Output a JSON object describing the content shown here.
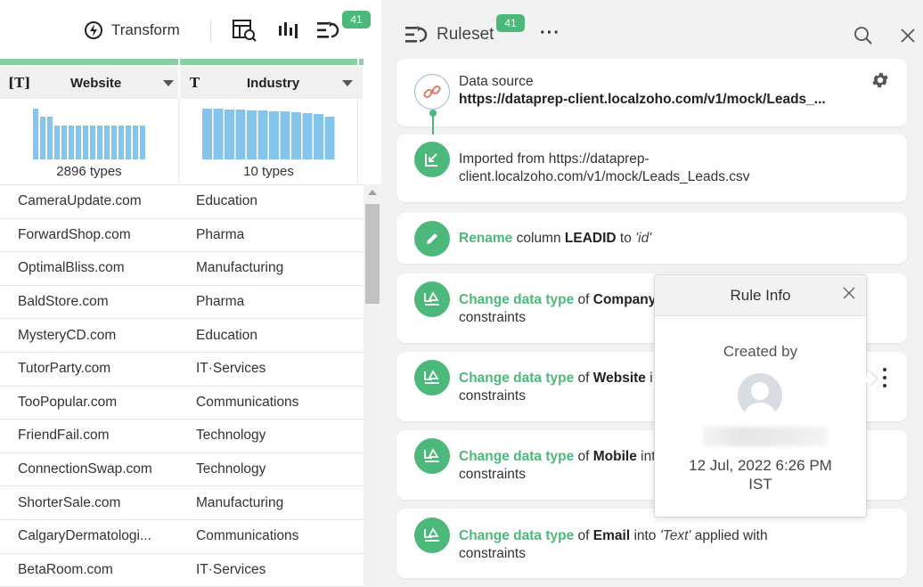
{
  "toolbar": {
    "transform_label": "Transform",
    "ruleset_badge": "41"
  },
  "grid": {
    "columns": [
      {
        "type_icon": "text-type-icon",
        "type_glyph": "[T]",
        "name": "Website",
        "histogram_caption": "2896 types"
      },
      {
        "type_icon": "text-type-icon",
        "type_glyph": "T",
        "name": "Industry",
        "histogram_caption": "10 types"
      }
    ],
    "rows": [
      [
        "CameraUpdate.com",
        "Education"
      ],
      [
        "ForwardShop.com",
        "Pharma"
      ],
      [
        "OptimalBliss.com",
        "Manufacturing"
      ],
      [
        "BaldStore.com",
        "Pharma"
      ],
      [
        "MysteryCD.com",
        "Education"
      ],
      [
        "TutorParty.com",
        "IT·Services"
      ],
      [
        "TooPopular.com",
        "Communications"
      ],
      [
        "FriendFail.com",
        "Technology"
      ],
      [
        "ConnectionSwap.com",
        "Technology"
      ],
      [
        "ShorterSale.com",
        "Manufacturing"
      ],
      [
        "CalgaryDermatologi...",
        "Communications"
      ],
      [
        "BetaRoom.com",
        "IT·Services"
      ]
    ]
  },
  "ruleset": {
    "title": "Ruleset",
    "badge": "41",
    "more": "···",
    "data_source_label": "Data source",
    "data_source_url": "https://dataprep-client.localzoho.com/v1/mock/Leads_...",
    "imported_text_1": "Imported from https://dataprep-",
    "imported_text_2": "client.localzoho.com/v1/mock/Leads_Leads.csv",
    "rename": {
      "action": "Rename",
      "text_1": "column",
      "column": "LEADID",
      "text_2": "to",
      "value": "'id'"
    },
    "change_company": {
      "action": "Change data type",
      "text_1": "of",
      "column": "Company",
      "line2": "constraints"
    },
    "change_website": {
      "action": "Change data type",
      "text_1": "of",
      "column": "Website",
      "tail": "i",
      "line2": "constraints"
    },
    "change_mobile": {
      "action": "Change data type",
      "text_1": "of",
      "column": "Mobile",
      "tail": "int",
      "line2": "constraints"
    },
    "change_email": {
      "action": "Change data type",
      "text_1": "of",
      "column": "Email",
      "text_2": "into",
      "value": "'Text'",
      "text_3": "applied with",
      "line2": "constraints"
    }
  },
  "rule_info": {
    "title": "Rule Info",
    "created_by_label": "Created by",
    "date_line_1": "12 Jul, 2022 6:26 PM",
    "date_line_2": "IST"
  },
  "colors": {
    "accent": "#4cb87a",
    "histogram_bar": "#85c5ec",
    "link_icon": "#e07b6b"
  }
}
